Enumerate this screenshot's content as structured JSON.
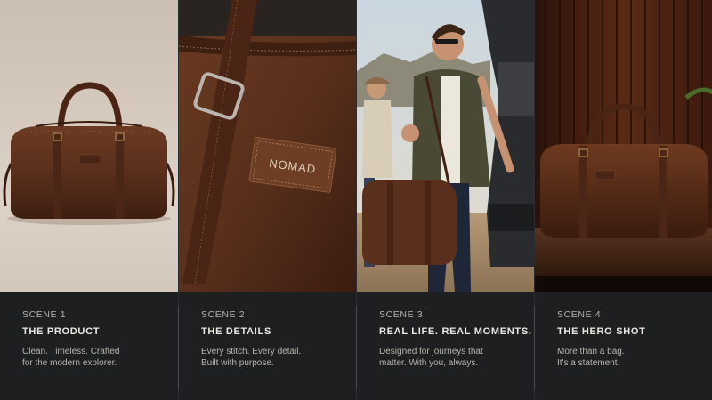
{
  "scenes": [
    {
      "number": "SCENE 1",
      "title": "THE PRODUCT",
      "description": [
        "Clean. Timeless. Crafted",
        "for the modern explorer."
      ]
    },
    {
      "number": "SCENE 2",
      "title": "THE DETAILS",
      "description": [
        "Every stitch. Every detail.",
        "Built with purpose."
      ],
      "patch_text": "NOMAD"
    },
    {
      "number": "SCENE 3",
      "title": "REAL LIFE. REAL MOMENTS.",
      "description": [
        "Designed for journeys that",
        "matter. With you, always."
      ]
    },
    {
      "number": "SCENE 4",
      "title": "THE HERO SHOT",
      "description": [
        "More than a bag.",
        "It's a statement."
      ]
    }
  ],
  "colors": {
    "caption_bg": "#1e1f21",
    "leather": "#5a2f1c",
    "heading": "#ece7e0",
    "body_text": "#b9b5ae"
  }
}
